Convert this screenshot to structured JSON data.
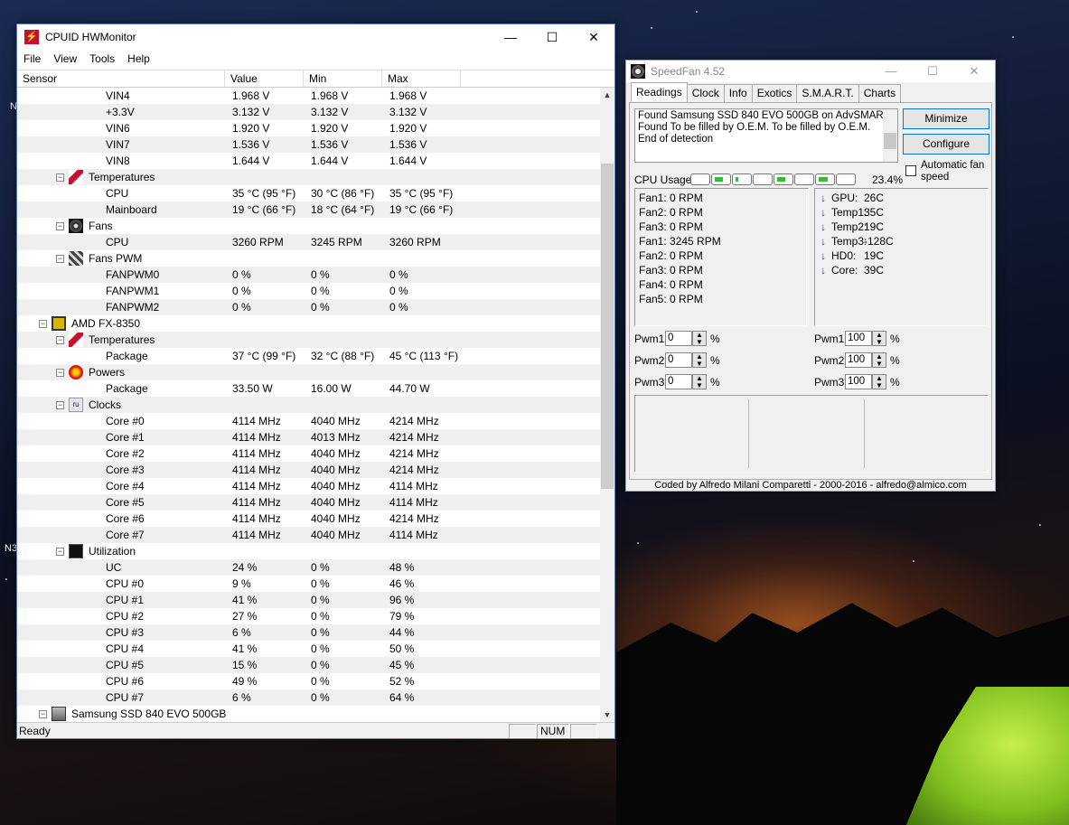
{
  "desktop": {
    "fragment_1": "N",
    "fragment_2": "N3"
  },
  "hwmonitor": {
    "title": "CPUID HWMonitor",
    "app_icon": "cpuid-icon",
    "window_buttons": {
      "minimize": "—",
      "maximize": "☐",
      "close": "✕"
    },
    "menu": [
      "File",
      "View",
      "Tools",
      "Help"
    ],
    "columns": [
      "Sensor",
      "Value",
      "Min",
      "Max"
    ],
    "rows": [
      {
        "indent": 3,
        "name": "VIN4",
        "value": "1.968 V",
        "min": "1.968 V",
        "max": "1.968 V"
      },
      {
        "indent": 3,
        "name": "+3.3V",
        "value": "3.132 V",
        "min": "3.132 V",
        "max": "3.132 V"
      },
      {
        "indent": 3,
        "name": "VIN6",
        "value": "1.920 V",
        "min": "1.920 V",
        "max": "1.920 V"
      },
      {
        "indent": 3,
        "name": "VIN7",
        "value": "1.536 V",
        "min": "1.536 V",
        "max": "1.536 V"
      },
      {
        "indent": 3,
        "name": "VIN8",
        "value": "1.644 V",
        "min": "1.644 V",
        "max": "1.644 V"
      },
      {
        "indent": 2,
        "group": true,
        "icon": "thermometer-icon",
        "name": "Temperatures",
        "value": "",
        "min": "",
        "max": ""
      },
      {
        "indent": 3,
        "name": "CPU",
        "value": "35 °C  (95 °F)",
        "min": "30 °C  (86 °F)",
        "max": "35 °C  (95 °F)"
      },
      {
        "indent": 3,
        "name": "Mainboard",
        "value": "19 °C  (66 °F)",
        "min": "18 °C  (64 °F)",
        "max": "19 °C  (66 °F)"
      },
      {
        "indent": 2,
        "group": true,
        "icon": "fan-icon",
        "name": "Fans",
        "value": "",
        "min": "",
        "max": ""
      },
      {
        "indent": 3,
        "name": "CPU",
        "value": "3260 RPM",
        "min": "3245 RPM",
        "max": "3260 RPM"
      },
      {
        "indent": 2,
        "group": true,
        "icon": "fan-pwm-icon",
        "name": "Fans PWM",
        "value": "",
        "min": "",
        "max": ""
      },
      {
        "indent": 3,
        "name": "FANPWM0",
        "value": "0 %",
        "min": "0 %",
        "max": "0 %"
      },
      {
        "indent": 3,
        "name": "FANPWM1",
        "value": "0 %",
        "min": "0 %",
        "max": "0 %"
      },
      {
        "indent": 3,
        "name": "FANPWM2",
        "value": "0 %",
        "min": "0 %",
        "max": "0 %"
      },
      {
        "indent": 1,
        "group": true,
        "icon": "cpu-chip-icon",
        "name": "AMD FX-8350",
        "value": "",
        "min": "",
        "max": ""
      },
      {
        "indent": 2,
        "group": true,
        "icon": "thermometer-icon",
        "name": "Temperatures",
        "value": "",
        "min": "",
        "max": ""
      },
      {
        "indent": 3,
        "name": "Package",
        "value": "37 °C  (99 °F)",
        "min": "32 °C  (88 °F)",
        "max": "45 °C  (113 °F)"
      },
      {
        "indent": 2,
        "group": true,
        "icon": "power-icon",
        "name": "Powers",
        "value": "",
        "min": "",
        "max": ""
      },
      {
        "indent": 3,
        "name": "Package",
        "value": "33.50 W",
        "min": "16.00 W",
        "max": "44.70 W"
      },
      {
        "indent": 2,
        "group": true,
        "icon": "clock-icon",
        "name": "Clocks",
        "value": "",
        "min": "",
        "max": ""
      },
      {
        "indent": 3,
        "name": "Core #0",
        "value": "4114 MHz",
        "min": "4040 MHz",
        "max": "4214 MHz"
      },
      {
        "indent": 3,
        "name": "Core #1",
        "value": "4114 MHz",
        "min": "4013 MHz",
        "max": "4214 MHz"
      },
      {
        "indent": 3,
        "name": "Core #2",
        "value": "4114 MHz",
        "min": "4040 MHz",
        "max": "4214 MHz"
      },
      {
        "indent": 3,
        "name": "Core #3",
        "value": "4114 MHz",
        "min": "4040 MHz",
        "max": "4214 MHz"
      },
      {
        "indent": 3,
        "name": "Core #4",
        "value": "4114 MHz",
        "min": "4040 MHz",
        "max": "4114 MHz"
      },
      {
        "indent": 3,
        "name": "Core #5",
        "value": "4114 MHz",
        "min": "4040 MHz",
        "max": "4114 MHz"
      },
      {
        "indent": 3,
        "name": "Core #6",
        "value": "4114 MHz",
        "min": "4040 MHz",
        "max": "4214 MHz"
      },
      {
        "indent": 3,
        "name": "Core #7",
        "value": "4114 MHz",
        "min": "4040 MHz",
        "max": "4114 MHz"
      },
      {
        "indent": 2,
        "group": true,
        "icon": "utilization-icon",
        "name": "Utilization",
        "value": "",
        "min": "",
        "max": ""
      },
      {
        "indent": 3,
        "name": "UC",
        "value": "24 %",
        "min": "0 %",
        "max": "48 %"
      },
      {
        "indent": 3,
        "name": "CPU #0",
        "value": "9 %",
        "min": "0 %",
        "max": "46 %"
      },
      {
        "indent": 3,
        "name": "CPU #1",
        "value": "41 %",
        "min": "0 %",
        "max": "96 %"
      },
      {
        "indent": 3,
        "name": "CPU #2",
        "value": "27 %",
        "min": "0 %",
        "max": "79 %"
      },
      {
        "indent": 3,
        "name": "CPU #3",
        "value": "6 %",
        "min": "0 %",
        "max": "44 %"
      },
      {
        "indent": 3,
        "name": "CPU #4",
        "value": "41 %",
        "min": "0 %",
        "max": "50 %"
      },
      {
        "indent": 3,
        "name": "CPU #5",
        "value": "15 %",
        "min": "0 %",
        "max": "45 %"
      },
      {
        "indent": 3,
        "name": "CPU #6",
        "value": "49 %",
        "min": "0 %",
        "max": "52 %"
      },
      {
        "indent": 3,
        "name": "CPU #7",
        "value": "6 %",
        "min": "0 %",
        "max": "64 %"
      },
      {
        "indent": 1,
        "group": true,
        "icon": "ssd-icon",
        "name": "Samsung SSD 840 EVO 500GB",
        "value": "",
        "min": "",
        "max": ""
      }
    ],
    "status": {
      "text": "Ready",
      "num": "NUM"
    },
    "scroll": {
      "up": "▲",
      "down": "▼"
    }
  },
  "speedfan": {
    "title": "SpeedFan 4.52",
    "app_icon": "speedfan-icon",
    "window_buttons": {
      "minimize": "—",
      "maximize": "☐",
      "close": "✕"
    },
    "tabs": [
      "Readings",
      "Clock",
      "Info",
      "Exotics",
      "S.M.A.R.T.",
      "Charts"
    ],
    "active_tab": "Readings",
    "log_lines": [
      "Found Samsung SSD 840 EVO 500GB on AdvSMART",
      "Found To be filled by O.E.M. To be filled by O.E.M.",
      "End of detection"
    ],
    "minimize_label": "Minimize",
    "configure_label": "Configure",
    "auto_fan_label_1": "Automatic fan",
    "auto_fan_label_2": "speed",
    "cpu_usage_label": "CPU Usage",
    "cpu_usage_pct": "23.4%",
    "cpu_core_loads": [
      0.0,
      0.55,
      0.2,
      0.0,
      0.55,
      0.0,
      0.6,
      0.0
    ],
    "accent": "#2ec02e",
    "fans": [
      "Fan1: 0 RPM",
      "Fan2: 0 RPM",
      "Fan3: 0 RPM",
      "Fan1: 3245 RPM",
      "Fan2: 0 RPM",
      "Fan3: 0 RPM",
      "Fan4: 0 RPM",
      "Fan5: 0 RPM"
    ],
    "temps": [
      {
        "label": "GPU:",
        "value": "26C"
      },
      {
        "label": "Temp1:",
        "value": "35C"
      },
      {
        "label": "Temp2:",
        "value": "19C"
      },
      {
        "label": "Temp3:",
        "value": "-128C"
      },
      {
        "label": "HD0:",
        "value": "19C"
      },
      {
        "label": "Core:",
        "value": "39C"
      }
    ],
    "pwm_left": [
      {
        "label": "Pwm1:",
        "value": "0"
      },
      {
        "label": "Pwm2:",
        "value": "0"
      },
      {
        "label": "Pwm3:",
        "value": "0"
      }
    ],
    "pwm_right": [
      {
        "label": "Pwm1:",
        "value": "100"
      },
      {
        "label": "Pwm2:",
        "value": "100"
      },
      {
        "label": "Pwm3:",
        "value": "100"
      }
    ],
    "pct_symbol": "%",
    "footer": "Coded by Alfredo Milani Comparetti - 2000-2016 - alfredo@almico.com"
  }
}
